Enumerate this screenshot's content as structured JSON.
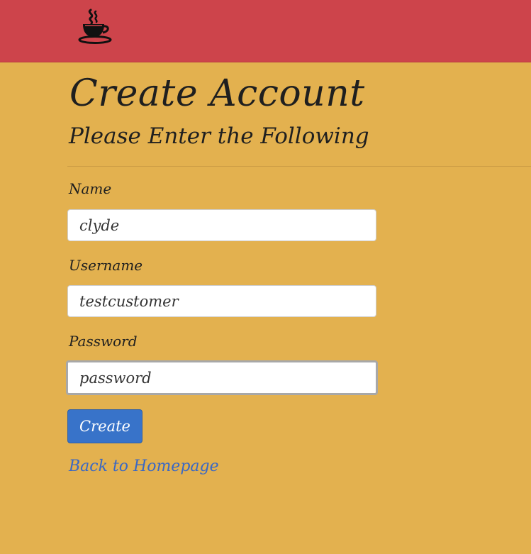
{
  "header": {
    "logo_icon": "coffee-cup-icon",
    "background_color": "#cd444b"
  },
  "page": {
    "title": "Create Account",
    "subtitle": "Please Enter the Following",
    "background_color": "#e3b14f"
  },
  "form": {
    "name": {
      "label": "Name",
      "value": "clyde"
    },
    "username": {
      "label": "Username",
      "value": "testcustomer"
    },
    "password": {
      "label": "Password",
      "value": "password"
    },
    "submit_label": "Create",
    "submit_color": "#3873c9"
  },
  "links": {
    "back_home": "Back to Homepage",
    "link_color": "#3a68c4"
  }
}
